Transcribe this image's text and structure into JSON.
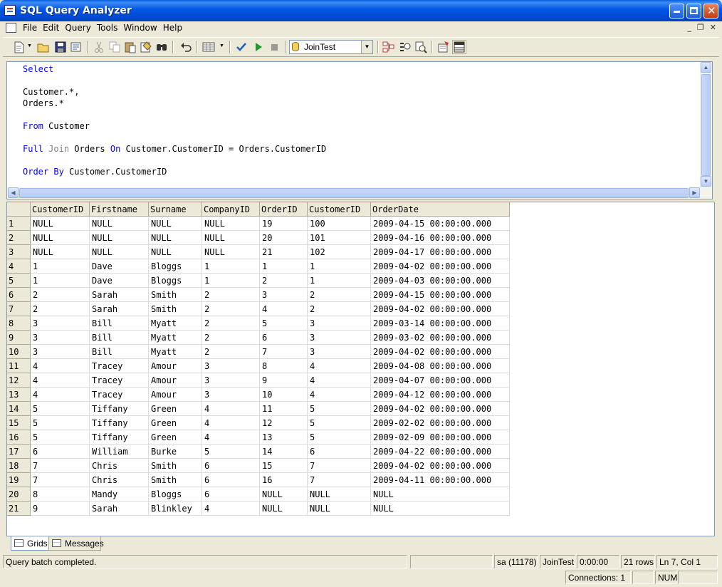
{
  "window": {
    "title": "SQL Query Analyzer"
  },
  "menu": {
    "items": [
      "File",
      "Edit",
      "Query",
      "Tools",
      "Window",
      "Help"
    ]
  },
  "toolbar": {
    "database": "JoinTest",
    "icons": [
      "new-query-icon",
      "open-icon",
      "save-icon",
      "load-script-icon",
      "cut-icon",
      "copy-icon",
      "paste-icon",
      "clear-icon",
      "find-icon",
      "undo-icon",
      "results-mode-icon",
      "parse-icon",
      "execute-icon",
      "stop-icon",
      "object-browser-icon",
      "object-search-icon",
      "show-plan-icon",
      "current-connection-icon",
      "results-pane-icon"
    ]
  },
  "editor": {
    "lines": [
      [
        {
          "t": "Select",
          "c": "kw"
        }
      ],
      [],
      [
        {
          "t": "Customer.*,",
          "c": ""
        }
      ],
      [
        {
          "t": "Orders.*",
          "c": ""
        }
      ],
      [],
      [
        {
          "t": "From",
          "c": "kw"
        },
        {
          "t": " Customer",
          "c": ""
        }
      ],
      [],
      [
        {
          "t": "Full",
          "c": "kw"
        },
        {
          "t": " ",
          "c": ""
        },
        {
          "t": "Join",
          "c": "kwg"
        },
        {
          "t": " Orders ",
          "c": ""
        },
        {
          "t": "On",
          "c": "kw"
        },
        {
          "t": " Customer.CustomerID = Orders.CustomerID",
          "c": ""
        }
      ],
      [],
      [
        {
          "t": "Order By",
          "c": "kw"
        },
        {
          "t": " Customer.CustomerID",
          "c": ""
        }
      ]
    ]
  },
  "results": {
    "columns": [
      "CustomerID",
      "Firstname",
      "Surname",
      "CompanyID",
      "OrderID",
      "CustomerID",
      "OrderDate"
    ],
    "rows": [
      [
        "1",
        "NULL",
        "NULL",
        "NULL",
        "NULL",
        "19",
        "100",
        "2009-04-15 00:00:00.000"
      ],
      [
        "2",
        "NULL",
        "NULL",
        "NULL",
        "NULL",
        "20",
        "101",
        "2009-04-16 00:00:00.000"
      ],
      [
        "3",
        "NULL",
        "NULL",
        "NULL",
        "NULL",
        "21",
        "102",
        "2009-04-17 00:00:00.000"
      ],
      [
        "4",
        "1",
        "Dave",
        "Bloggs",
        "1",
        "1",
        "1",
        "2009-04-02 00:00:00.000"
      ],
      [
        "5",
        "1",
        "Dave",
        "Bloggs",
        "1",
        "2",
        "1",
        "2009-04-03 00:00:00.000"
      ],
      [
        "6",
        "2",
        "Sarah",
        "Smith",
        "2",
        "3",
        "2",
        "2009-04-15 00:00:00.000"
      ],
      [
        "7",
        "2",
        "Sarah",
        "Smith",
        "2",
        "4",
        "2",
        "2009-04-02 00:00:00.000"
      ],
      [
        "8",
        "3",
        "Bill",
        "Myatt",
        "2",
        "5",
        "3",
        "2009-03-14 00:00:00.000"
      ],
      [
        "9",
        "3",
        "Bill",
        "Myatt",
        "2",
        "6",
        "3",
        "2009-03-02 00:00:00.000"
      ],
      [
        "10",
        "3",
        "Bill",
        "Myatt",
        "2",
        "7",
        "3",
        "2009-04-02 00:00:00.000"
      ],
      [
        "11",
        "4",
        "Tracey",
        "Amour",
        "3",
        "8",
        "4",
        "2009-04-08 00:00:00.000"
      ],
      [
        "12",
        "4",
        "Tracey",
        "Amour",
        "3",
        "9",
        "4",
        "2009-04-07 00:00:00.000"
      ],
      [
        "13",
        "4",
        "Tracey",
        "Amour",
        "3",
        "10",
        "4",
        "2009-04-12 00:00:00.000"
      ],
      [
        "14",
        "5",
        "Tiffany",
        "Green",
        "4",
        "11",
        "5",
        "2009-04-02 00:00:00.000"
      ],
      [
        "15",
        "5",
        "Tiffany",
        "Green",
        "4",
        "12",
        "5",
        "2009-02-02 00:00:00.000"
      ],
      [
        "16",
        "5",
        "Tiffany",
        "Green",
        "4",
        "13",
        "5",
        "2009-02-09 00:00:00.000"
      ],
      [
        "17",
        "6",
        "William",
        "Burke",
        "5",
        "14",
        "6",
        "2009-04-22 00:00:00.000"
      ],
      [
        "18",
        "7",
        "Chris",
        "Smith",
        "6",
        "15",
        "7",
        "2009-04-02 00:00:00.000"
      ],
      [
        "19",
        "7",
        "Chris",
        "Smith",
        "6",
        "16",
        "7",
        "2009-04-11 00:00:00.000"
      ],
      [
        "20",
        "8",
        "Mandy",
        "Bloggs",
        "6",
        "NULL",
        "NULL",
        "NULL"
      ],
      [
        "21",
        "9",
        "Sarah",
        "Blinkley",
        "4",
        "NULL",
        "NULL",
        "NULL"
      ]
    ]
  },
  "tabs": {
    "grids": "Grids",
    "messages": "Messages"
  },
  "status": {
    "message": "Query batch completed.",
    "user": "sa (11178)",
    "database": "JoinTest",
    "elapsed": "0:00:00",
    "rows": "21 rows",
    "position": "Ln 7, Col 1",
    "connections": "Connections: 1",
    "num": "NUM"
  },
  "colors": {
    "title_bar": "#0055e5",
    "keyword": "#0000ff",
    "keyword_gray": "#808080",
    "chrome": "#ece9d8"
  }
}
